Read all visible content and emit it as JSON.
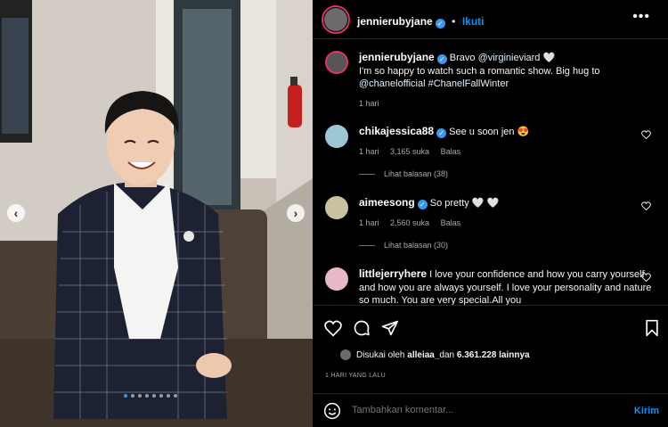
{
  "post": {
    "author": "jennierubyjane",
    "follow_label": "Ikuti",
    "more_label": "•••",
    "caption_prefix": "Bravo ",
    "caption_mention": "@virginieviard",
    "caption_heart": "🤍",
    "caption_line2": "I'm so happy to watch such a romantic show. Big hug to",
    "caption_mention2": "@chanelofficial",
    "caption_hashtag": "#ChanelFallWinter",
    "caption_time": "1 hari"
  },
  "comments": [
    {
      "user": "chikajessica88",
      "text": "See u soon jen 😍",
      "time": "1 hari",
      "likes": "3,165 suka",
      "reply_label": "Balas",
      "view_replies": "Lihat balasan (38)"
    },
    {
      "user": "aimeesong",
      "text": "So pretty 🤍 🤍",
      "time": "1 hari",
      "likes": "2,560 suka",
      "reply_label": "Balas",
      "view_replies": "Lihat balasan (30)"
    },
    {
      "user": "littlejerryhere",
      "text": "I love your confidence and how you carry yourself and how you are always yourself. I love your personality and nature so much. You are very special.All you"
    }
  ],
  "likes": {
    "prefix": "Disukai oleh ",
    "user": "alleiaa_",
    "middle": " dan ",
    "count": "6.361.228 lainnya"
  },
  "timestamp": "1 HARI YANG LALU",
  "add_comment": {
    "placeholder": "Tambahkan komentar...",
    "send_label": "Kirim"
  },
  "carousel": {
    "prev": "‹",
    "next": "›",
    "slide_count": 8,
    "active_index": 0
  }
}
